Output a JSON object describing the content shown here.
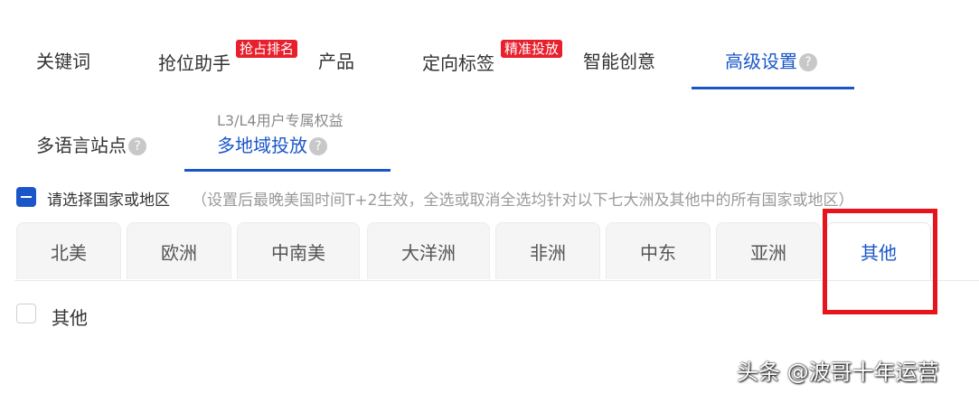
{
  "top_tabs": [
    {
      "label": "关键词"
    },
    {
      "label": "抢位助手",
      "badge": "抢占排名"
    },
    {
      "label": "产品"
    },
    {
      "label": "定向标签",
      "badge": "精准投放"
    },
    {
      "label": "智能创意"
    },
    {
      "label": "高级设置",
      "active": true,
      "help_icon": "?"
    }
  ],
  "sub_tabs": [
    {
      "label": "多语言站点",
      "help_icon": "?"
    },
    {
      "label": "多地域投放",
      "caption": "L3/L4用户专属权益",
      "active": true,
      "help_icon": "?"
    }
  ],
  "select_all": {
    "label": "请选择国家或地区",
    "hint": "（设置后最晚美国时间T+2生效，全选或取消全选均针对以下七大洲及其他中的所有国家或地区）",
    "state": "indeterminate"
  },
  "region_tabs": [
    {
      "label": "北美"
    },
    {
      "label": "欧洲"
    },
    {
      "label": "中南美"
    },
    {
      "label": "大洋洲"
    },
    {
      "label": "非洲"
    },
    {
      "label": "中东"
    },
    {
      "label": "亚洲"
    },
    {
      "label": "其他",
      "active": true
    }
  ],
  "region_options": [
    {
      "label": "其他",
      "checked": false
    }
  ],
  "watermark": "头条 @波哥十年运营",
  "colors": {
    "accent": "#1a56c8",
    "badge": "#e8202e",
    "highlight_box": "#e8141c"
  }
}
